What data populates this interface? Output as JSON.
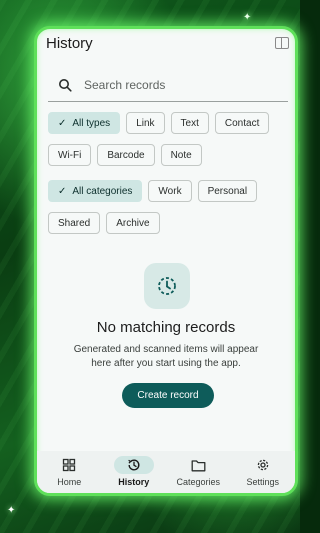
{
  "header": {
    "title": "History"
  },
  "search": {
    "placeholder": "Search records"
  },
  "type_filters": [
    {
      "label": "All types",
      "selected": true
    },
    {
      "label": "Link",
      "selected": false
    },
    {
      "label": "Text",
      "selected": false
    },
    {
      "label": "Contact",
      "selected": false
    },
    {
      "label": "Wi-Fi",
      "selected": false
    },
    {
      "label": "Barcode",
      "selected": false
    },
    {
      "label": "Note",
      "selected": false
    }
  ],
  "category_filters": [
    {
      "label": "All categories",
      "selected": true
    },
    {
      "label": "Work",
      "selected": false
    },
    {
      "label": "Personal",
      "selected": false
    },
    {
      "label": "Shared",
      "selected": false
    },
    {
      "label": "Archive",
      "selected": false
    }
  ],
  "empty_state": {
    "icon": "history-clock-icon",
    "title": "No matching records",
    "body": "Generated and scanned items will appear here after you start using the app.",
    "button": "Create record"
  },
  "bottom_nav": [
    {
      "label": "Home",
      "icon": "grid-icon",
      "active": false
    },
    {
      "label": "History",
      "icon": "history-icon",
      "active": true
    },
    {
      "label": "Categories",
      "icon": "folder-icon",
      "active": false
    },
    {
      "label": "Settings",
      "icon": "gear-icon",
      "active": false
    }
  ],
  "colors": {
    "accent": "#0e5c5a",
    "chip_selected": "#cfe6e3",
    "frame_glow": "#5fe05a"
  }
}
